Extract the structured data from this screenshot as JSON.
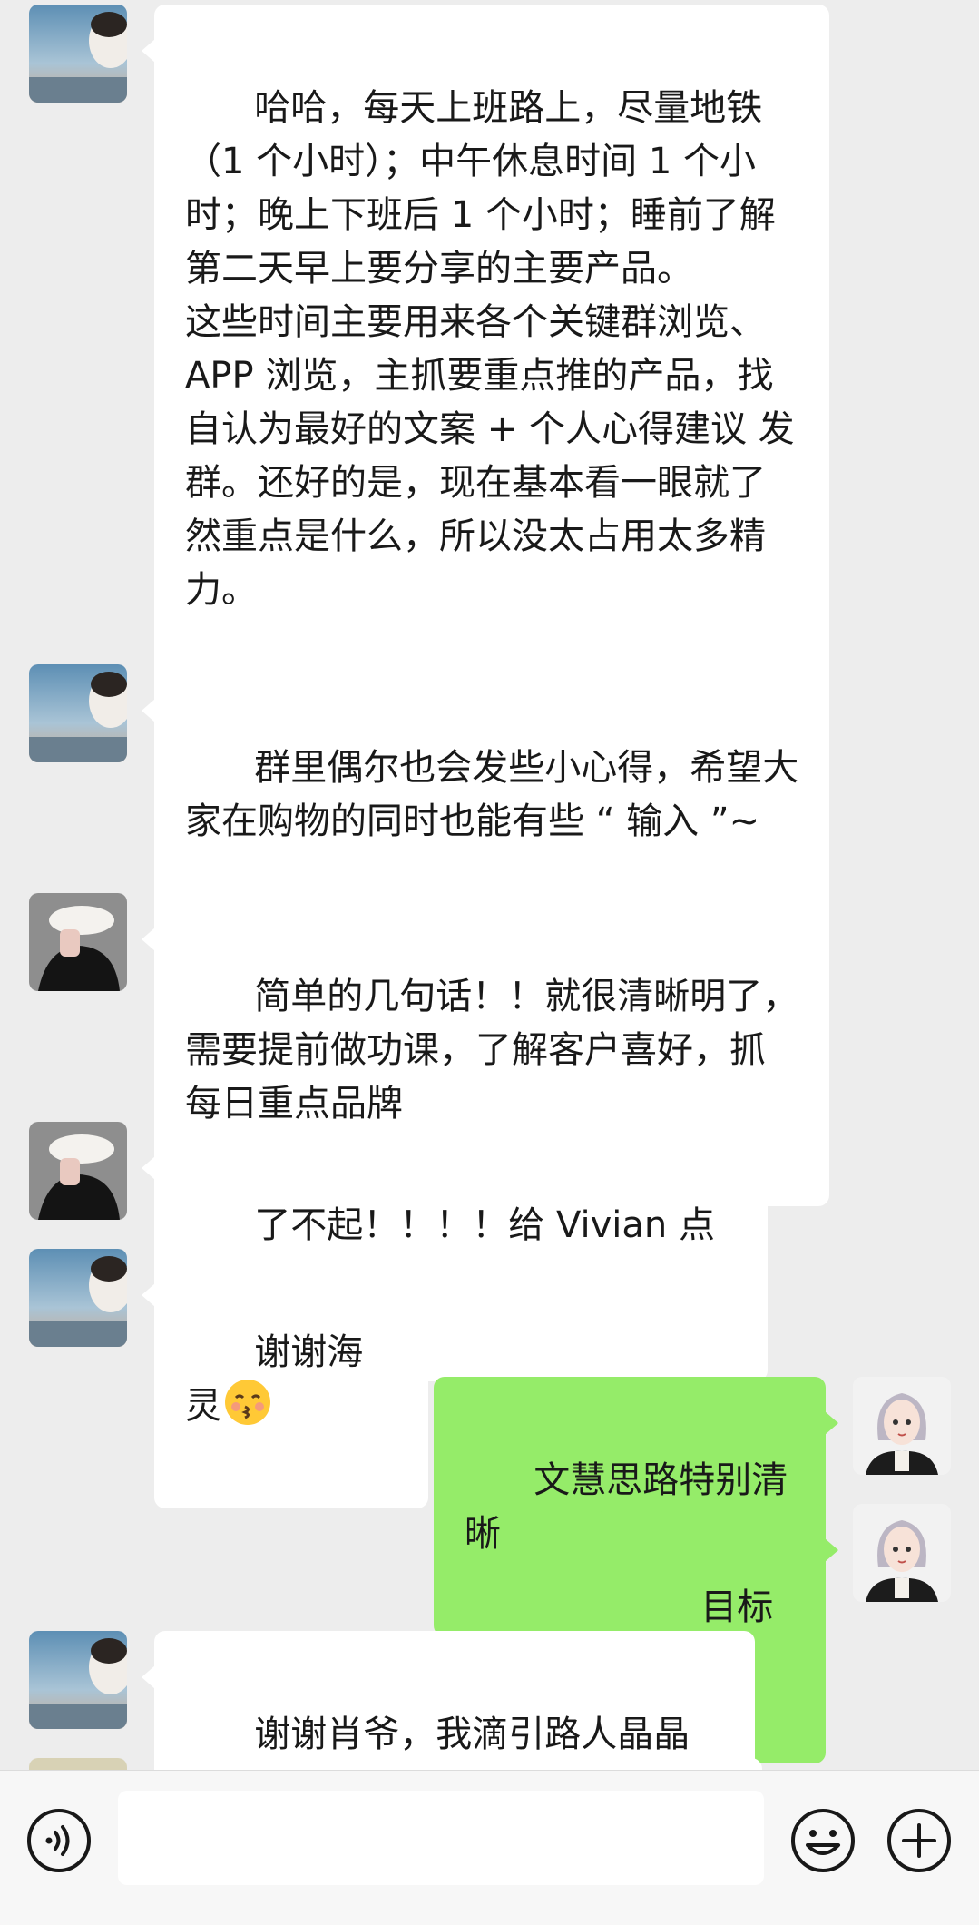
{
  "messages": [
    {
      "side": "in",
      "avatar": "sunset-avatar",
      "text": "哈哈，每天上班路上，尽量地铁（1 个小时）；中午休息时间 1 个小时；晚上下班后 1 个小时；睡前了解第二天早上要分享的主要产品。\n这些时间主要用来各个关键群浏览、APP 浏览，主抓要重点推的产品，找自认为最好的文案 + 个人心得建议 发群。还好的是，现在基本看一眼就了然重点是什么，所以没太占用太多精力。"
    },
    {
      "side": "in",
      "avatar": "sunset-avatar",
      "text": "群里偶尔也会发些小心得，希望大家在购物的同时也能有些 “ 输入 ”~"
    },
    {
      "side": "in",
      "avatar": "hat-avatar",
      "text": "简单的几句话！！就很清晰明了，需要提前做功课，了解客户喜好，抓每日重点品牌"
    },
    {
      "side": "in",
      "avatar": "hat-avatar",
      "text": "了不起！！！！给 Vivian 点赞"
    },
    {
      "side": "in",
      "avatar": "sunset-avatar",
      "text": "谢谢海灵",
      "emoji": "kissing-face"
    },
    {
      "side": "out",
      "avatar": "cartoon-girl-avatar",
      "text": "文慧思路特别清晰"
    },
    {
      "side": "out",
      "avatar": "cartoon-girl-avatar",
      "text": "目标明确"
    },
    {
      "side": "in",
      "avatar": "sunset-avatar",
      "text": "谢谢肖爷，我滴引路人晶晶 ~"
    }
  ],
  "input": {
    "placeholder": "",
    "value": ""
  },
  "icons": {
    "voice": "voice-icon",
    "emoji": "emoji-icon",
    "plus": "plus-icon"
  },
  "colors": {
    "bg": "#ededed",
    "in_bubble": "#ffffff",
    "out_bubble": "#95ec69"
  }
}
